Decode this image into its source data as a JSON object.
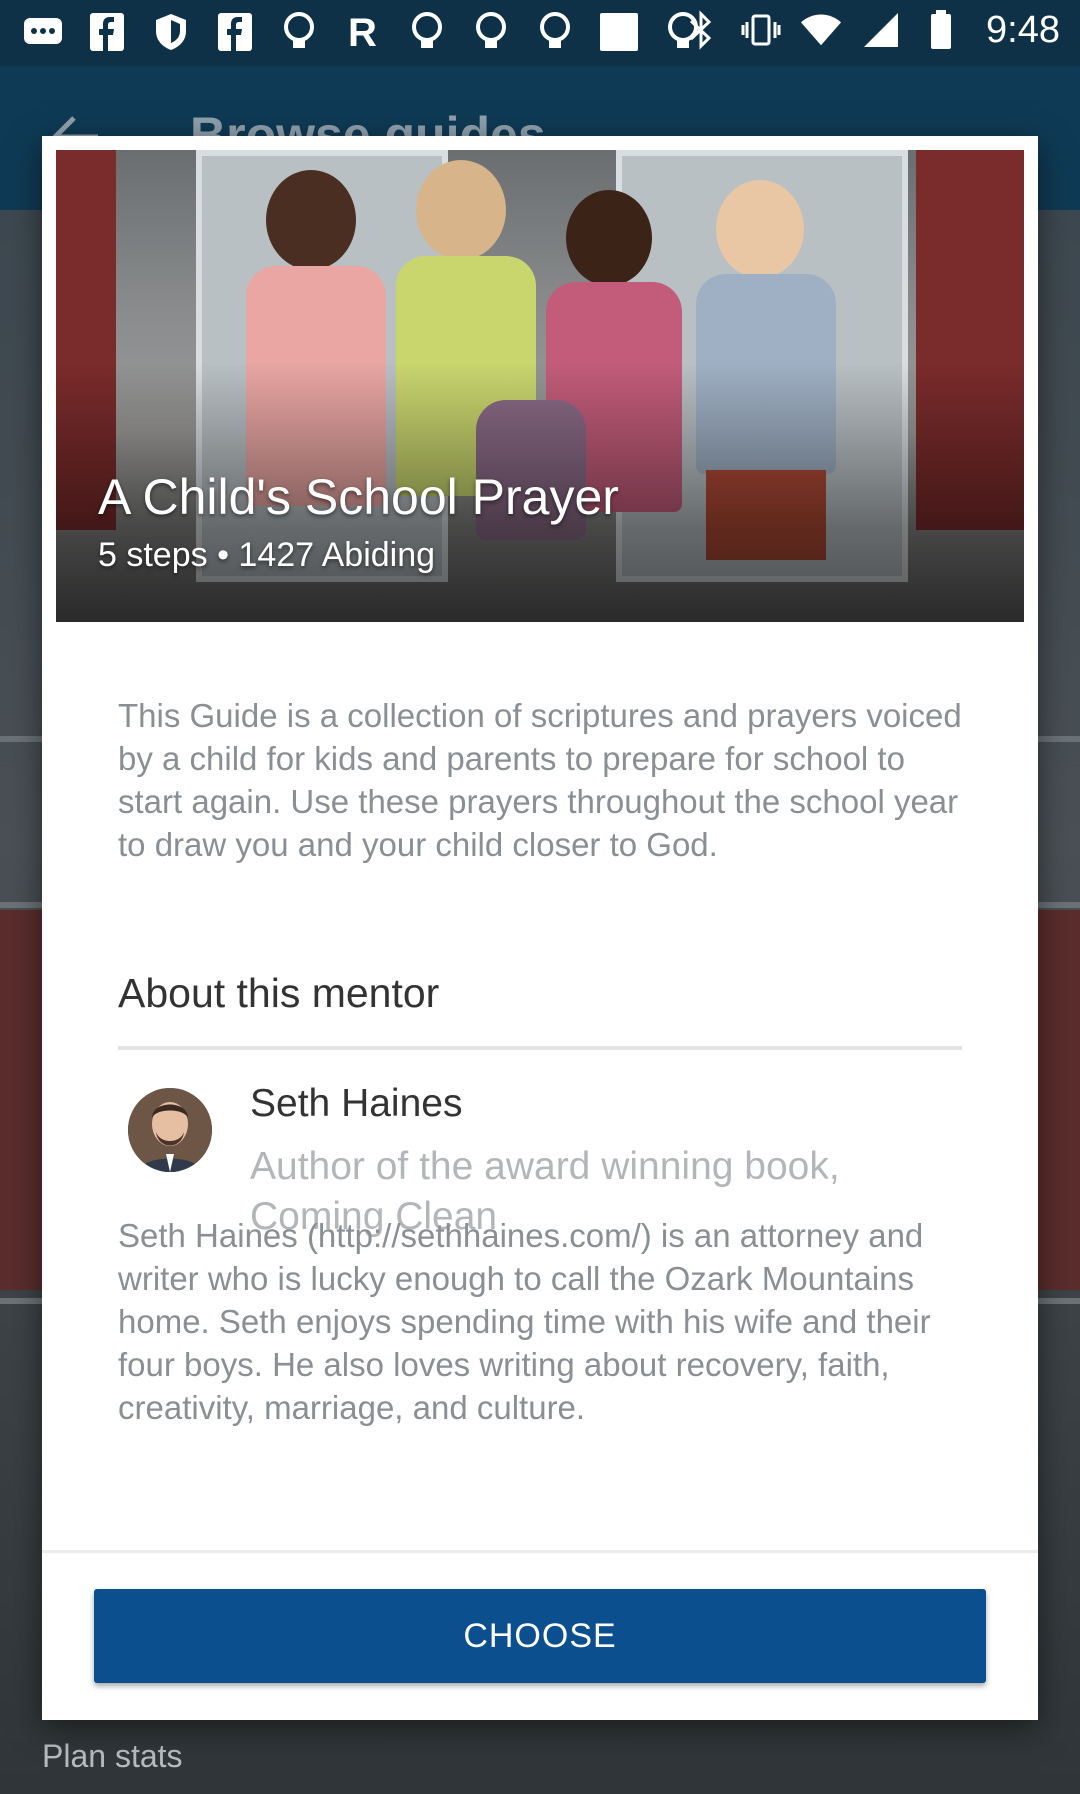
{
  "status_bar": {
    "time": "9:48",
    "left_icons": [
      "messages-icon",
      "facebook-icon",
      "shield-icon",
      "facebook-icon",
      "lightbulb-icon",
      "r-app-icon",
      "lightbulb-icon",
      "lightbulb-icon",
      "lightbulb-icon",
      "square-icon",
      "lightbulb-icon"
    ],
    "right_icons": [
      "bluetooth-icon",
      "vibrate-icon",
      "wifi-icon",
      "signal-icon",
      "battery-icon"
    ]
  },
  "background": {
    "title": "Browse guides",
    "plan_stats": "Plan stats"
  },
  "dialog": {
    "title": "A Child's School Prayer",
    "meta": "5 steps • 1427 Abiding",
    "description": "This Guide is a collection of scriptures and prayers voiced by a child for kids and parents to prepare for school to start again. Use these prayers throughout the school year to draw you and your child closer to God.",
    "about_heading": "About this mentor",
    "mentor": {
      "name": "Seth Haines",
      "title": "Author of the award winning book, Coming Clean",
      "bio": "Seth Haines (http://sethhaines.com/) is an attorney and writer who is lucky enough to call the Ozark Mountains home. Seth enjoys spending time with his wife and their four boys. He also loves writing about recovery, faith, creativity, marriage, and culture."
    },
    "choose_label": "CHOOSE"
  },
  "colors": {
    "status_bar": "#0e3147",
    "primary_button": "#0b4f8f",
    "body_text": "#8a8f93",
    "heading_text": "#333333"
  }
}
